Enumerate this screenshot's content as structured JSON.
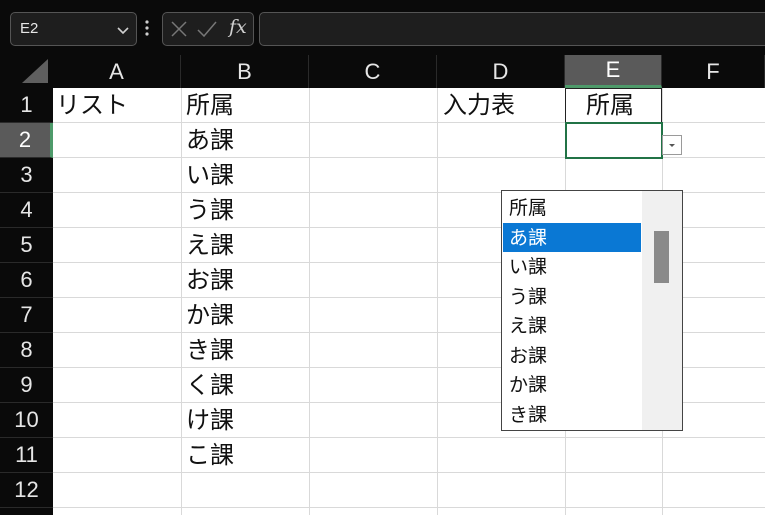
{
  "formula_bar": {
    "name_box": "E2",
    "fx": "fx",
    "formula_value": ""
  },
  "columns": [
    "A",
    "B",
    "C",
    "D",
    "E",
    "F"
  ],
  "active_column": "E",
  "rows": [
    "1",
    "2",
    "3",
    "4",
    "5",
    "6",
    "7",
    "8",
    "9",
    "10",
    "11",
    "12"
  ],
  "active_row": "2",
  "cells": {
    "A1": "リスト",
    "B1": "所属",
    "B2": "あ課",
    "B3": "い課",
    "B4": "う課",
    "B5": "え課",
    "B6": "お課",
    "B7": "か課",
    "B8": "き課",
    "B9": "く課",
    "B10": "け課",
    "B11": "こ課",
    "D1": "入力表",
    "E1": "所属",
    "E2": ""
  },
  "dropdown": {
    "items": [
      "所属",
      "あ課",
      "い課",
      "う課",
      "え課",
      "お課",
      "か課",
      "き課"
    ],
    "selected": "あ課"
  },
  "colors": {
    "accent_green": "#217346",
    "selection_blue": "#0a78d4",
    "header_active": "#5a5a5a"
  },
  "icons": {
    "cancel": "x-icon",
    "enter": "checkmark-icon",
    "name_box_dropdown": "chevron-down-icon",
    "cell_dropdown": "triangle-down-icon"
  }
}
